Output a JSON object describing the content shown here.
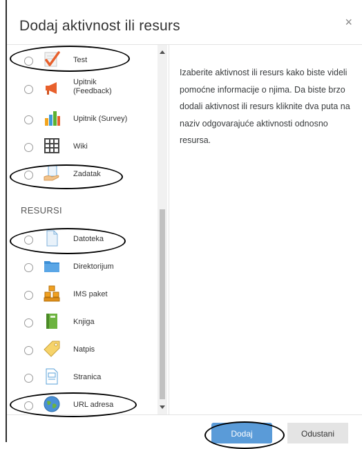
{
  "modal": {
    "title": "Dodaj aktivnost ili resurs",
    "close_symbol": "×"
  },
  "activities": [
    {
      "label": "Test",
      "icon": "quiz-icon"
    },
    {
      "label": "Upitnik\n(Feedback)",
      "icon": "megaphone-icon"
    },
    {
      "label": "Upitnik (Survey)",
      "icon": "bar-chart-icon"
    },
    {
      "label": "Wiki",
      "icon": "wiki-icon"
    },
    {
      "label": "Zadatak",
      "icon": "assignment-hand-icon"
    }
  ],
  "resources_header": "RESURSI",
  "resources": [
    {
      "label": "Datoteka",
      "icon": "file-icon"
    },
    {
      "label": "Direktorijum",
      "icon": "folder-icon"
    },
    {
      "label": "IMS paket",
      "icon": "ims-package-icon"
    },
    {
      "label": "Knjiga",
      "icon": "book-icon"
    },
    {
      "label": "Natpis",
      "icon": "label-tag-icon"
    },
    {
      "label": "Stranica",
      "icon": "page-icon"
    },
    {
      "label": "URL adresa",
      "icon": "url-globe-icon"
    }
  ],
  "help_text": "Izaberite aktivnost ili resurs kako biste videli pomoćne informacije o njima. Da biste brzo dodali aktivnost ili resurs kliknite dva puta na naziv odgovarajuće aktivnosti odnosno resursa.",
  "buttons": {
    "add": "Dodaj",
    "cancel": "Odustani"
  },
  "colors": {
    "primary_button": "#5a9bd8",
    "secondary_button": "#e4e4e4"
  }
}
